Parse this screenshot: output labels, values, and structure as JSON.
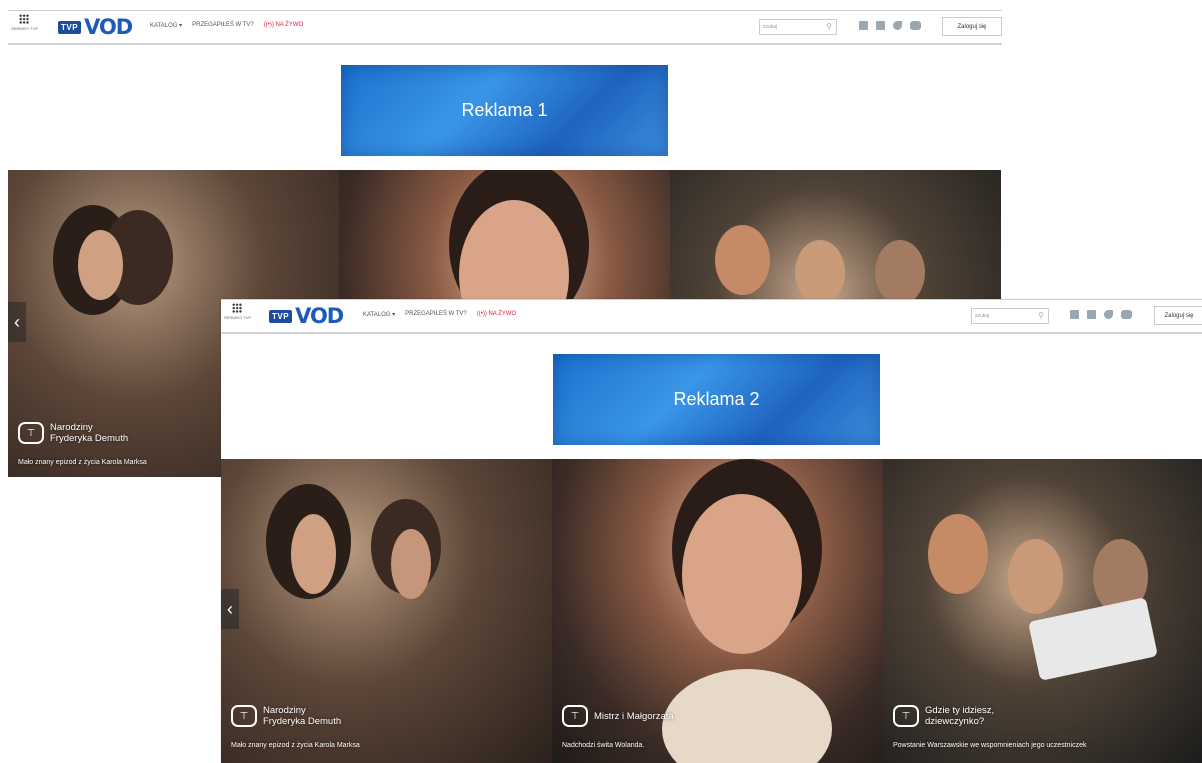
{
  "header": {
    "apps_label": "SERWISY TVP",
    "logo_tvp": "TVP",
    "logo_vod": "VOD",
    "nav": [
      "KATALOG ▾",
      "PRZEGAPIŁEŚ W TV?",
      "((•)) NA ŻYWO"
    ],
    "search_placeholder": "szukaj",
    "login": "Zaloguj się"
  },
  "back": {
    "ad": "Reklama 1"
  },
  "front": {
    "ad": "Reklama 2"
  },
  "slides": [
    {
      "title_line1": "Narodziny",
      "title_line2": "Fryderyka Demuth",
      "desc": "Mało znany epizod z życia Karola Marksa"
    },
    {
      "title_line1": "Mistrz i Małgorzata",
      "title_line2": "",
      "desc": "Nadchodzi świta Wolanda."
    },
    {
      "title_line1": "Gdzie ty idziesz,",
      "title_line2": "dziewczynko?",
      "desc": "Powstanie Warszawskie we wspomnieniach jego uczestniczek"
    }
  ],
  "icons": {
    "prev": "chevron-left-icon",
    "search": "search-icon",
    "apps": "apps-grid-icon",
    "tv": "tv-icon"
  },
  "colors": {
    "brand": "#1e5bb8",
    "live": "#e21a3c",
    "ad": "#2a82db"
  }
}
